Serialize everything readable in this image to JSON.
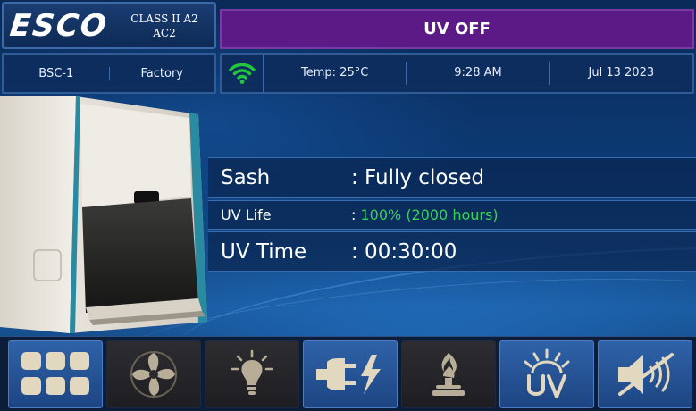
{
  "header": {
    "logo_text": "ESCO",
    "cabinet_class_line1": "CLASS II A2",
    "cabinet_class_line2": "AC2",
    "uv_status": "UV OFF",
    "status_banner_color": "#5c1a86"
  },
  "info": {
    "device_name": "BSC-1",
    "mode": "Factory",
    "wifi_icon": "wifi-icon",
    "wifi_color": "#22c83c",
    "temperature": "Temp: 25°C",
    "time": "9:28 AM",
    "date": "Jul 13 2023"
  },
  "status": {
    "sash_label": "Sash",
    "sash_value": ": Fully closed",
    "uv_life_label": "UV Life",
    "uv_life_colon": ":",
    "uv_life_value": "100% (2000 hours)",
    "uv_life_color": "#35d35a",
    "uv_time_label": "UV Time",
    "uv_time_value": ": 00:30:00"
  },
  "toolbar": {
    "buttons": [
      {
        "icon": "menu-grid-icon",
        "state": "active"
      },
      {
        "icon": "fan-icon",
        "state": "inactive"
      },
      {
        "icon": "light-bulb-icon",
        "state": "inactive"
      },
      {
        "icon": "power-outlet-icon",
        "state": "active"
      },
      {
        "icon": "gas-burner-icon",
        "state": "inactive"
      },
      {
        "icon": "uv-lamp-icon",
        "state": "active"
      },
      {
        "icon": "mute-alarm-icon",
        "state": "active"
      }
    ]
  },
  "colors": {
    "accent_blue": "#2f62a8",
    "icon_beige": "#e2d8c0",
    "background": "#0d3c78"
  }
}
